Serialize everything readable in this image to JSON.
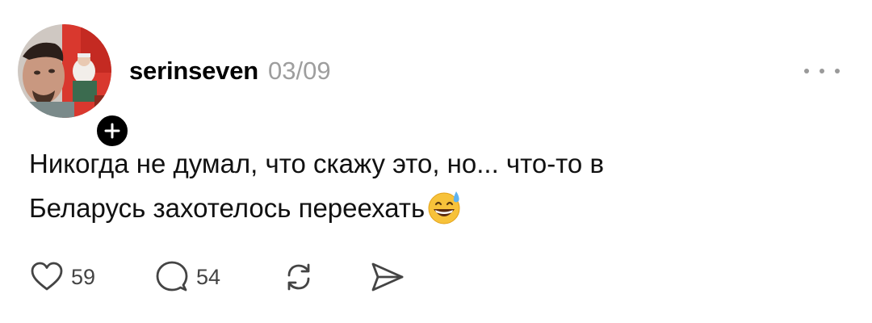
{
  "post": {
    "author": {
      "username": "serinseven",
      "avatar": "avatar-photo",
      "follow_icon": "plus-icon"
    },
    "timestamp": "03/09",
    "more_icon": "more-horizontal-icon",
    "text_lines": [
      "Никогда не думал, что скажу это, но... что-то в",
      "Беларусь захотелось переехать"
    ],
    "emoji": "grinning-face-with-sweat-emoji",
    "actions": {
      "like": {
        "icon": "heart-icon",
        "count": "59"
      },
      "comment": {
        "icon": "comment-icon",
        "count": "54"
      },
      "repost": {
        "icon": "repost-icon"
      },
      "share": {
        "icon": "send-icon"
      }
    }
  },
  "colors": {
    "text": "#111111",
    "muted": "#9e9e9e",
    "icon": "#444444",
    "badge": "#000000"
  }
}
